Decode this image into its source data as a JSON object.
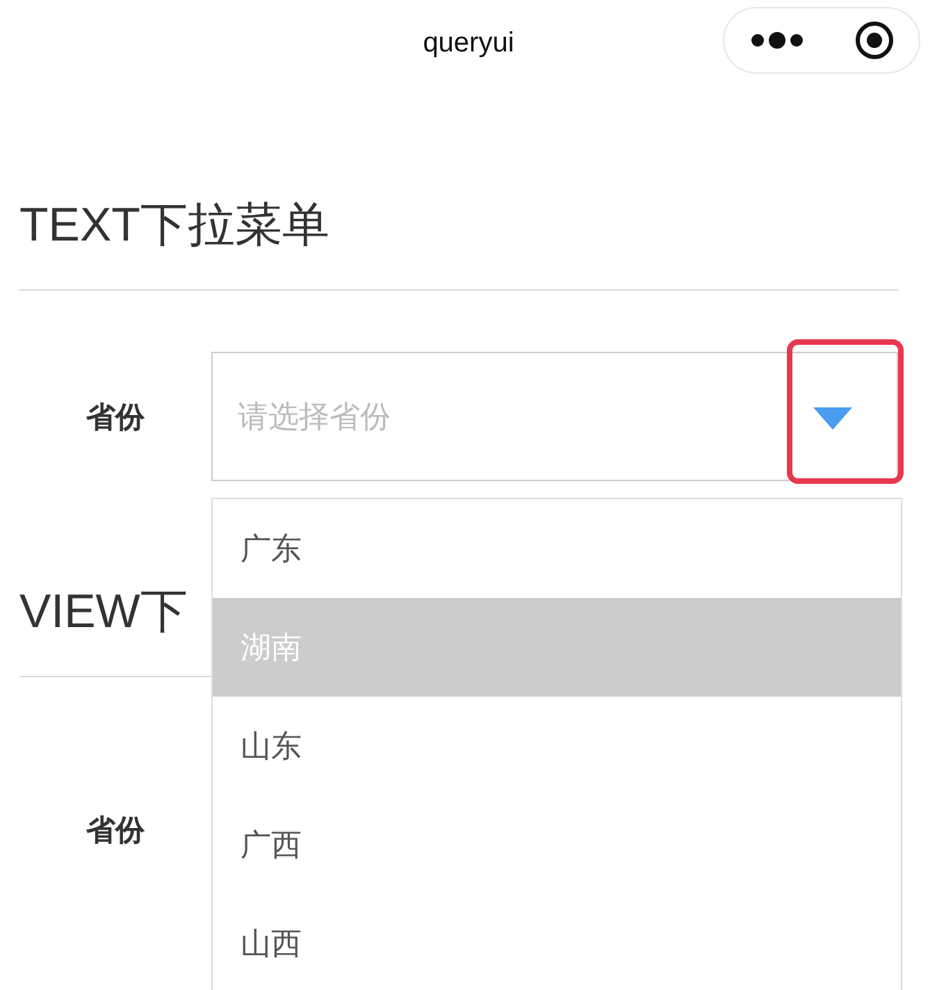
{
  "nav_bar": {
    "title": "queryui"
  },
  "sections": [
    {
      "title": "TEXT下拉菜单",
      "label": "省份",
      "placeholder": "请选择省份",
      "arrow_annotated": true,
      "expanded": true,
      "options": [
        {
          "label": "广东",
          "selected": false
        },
        {
          "label": "湖南",
          "selected": true
        },
        {
          "label": "山东",
          "selected": false
        },
        {
          "label": "广西",
          "selected": false
        },
        {
          "label": "山西",
          "selected": false
        }
      ]
    },
    {
      "title": "VIEW下",
      "label": "省份"
    }
  ]
}
